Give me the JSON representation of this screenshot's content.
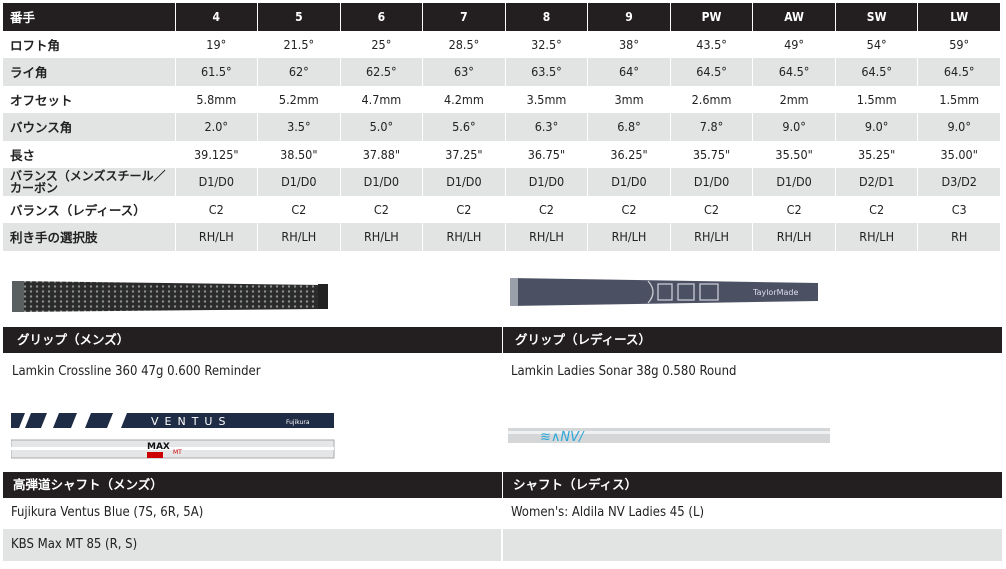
{
  "spec_table": {
    "header_label": "番手",
    "columns": [
      "4",
      "5",
      "6",
      "7",
      "8",
      "9",
      "PW",
      "AW",
      "SW",
      "LW"
    ],
    "rows": [
      {
        "label": "ロフト角",
        "values": [
          "19°",
          "21.5°",
          "25°",
          "28.5°",
          "32.5°",
          "38°",
          "43.5°",
          "49°",
          "54°",
          "59°"
        ]
      },
      {
        "label": "ライ角",
        "values": [
          "61.5°",
          "62°",
          "62.5°",
          "63°",
          "63.5°",
          "64°",
          "64.5°",
          "64.5°",
          "64.5°",
          "64.5°"
        ]
      },
      {
        "label": "オフセット",
        "values": [
          "5.8mm",
          "5.2mm",
          "4.7mm",
          "4.2mm",
          "3.5mm",
          "3mm",
          "2.6mm",
          "2mm",
          "1.5mm",
          "1.5mm"
        ]
      },
      {
        "label": "バウンス角",
        "values": [
          "2.0°",
          "3.5°",
          "5.0°",
          "5.6°",
          "6.3°",
          "6.8°",
          "7.8°",
          "9.0°",
          "9.0°",
          "9.0°"
        ]
      },
      {
        "label": "長さ",
        "values": [
          "39.125\"",
          "38.50\"",
          "37.88\"",
          "37.25\"",
          "36.75\"",
          "36.25\"",
          "35.75\"",
          "35.50\"",
          "35.25\"",
          "35.00\""
        ]
      },
      {
        "label": "バランス（メンズスチール／カーボン",
        "values": [
          "D1/D0",
          "D1/D0",
          "D1/D0",
          "D1/D0",
          "D1/D0",
          "D1/D0",
          "D1/D0",
          "D1/D0",
          "D2/D1",
          "D3/D2"
        ]
      },
      {
        "label": "バランス（レディース）",
        "values": [
          "C2",
          "C2",
          "C2",
          "C2",
          "C2",
          "C2",
          "C2",
          "C2",
          "C2",
          "C3"
        ]
      },
      {
        "label": "利き手の選択肢",
        "values": [
          "RH/LH",
          "RH/LH",
          "RH/LH",
          "RH/LH",
          "RH/LH",
          "RH/LH",
          "RH/LH",
          "RH/LH",
          "RH/LH",
          "RH"
        ]
      }
    ]
  },
  "grips": {
    "mens": {
      "title": "グリップ（メンズ）",
      "value": "Lamkin Crossline 360 47g 0.600 Reminder"
    },
    "ladies": {
      "title": "グリップ（レディース）",
      "value": "Lamkin Ladies Sonar 38g 0.580 Round",
      "logo": "TaylorMade"
    }
  },
  "shafts": {
    "mens": {
      "title": "高弾道シャフト（メンズ）",
      "values": [
        "Fujikura Ventus Blue (7S, 6R, 5A)",
        "KBS Max MT 85 (R, S)"
      ],
      "logos": [
        "VENTUS",
        "Fujikura",
        "MAX",
        "MT",
        "KBS"
      ]
    },
    "ladies": {
      "title": "シャフト（レディス）",
      "values": [
        "Women's: Aldila NV Ladies 45 (L)"
      ],
      "logos": [
        "NV"
      ]
    }
  },
  "colors": {
    "header_bg": "#231f20",
    "stripe": "#e2e3e3",
    "ladies_shaft_accent": "#2aa7d8"
  }
}
